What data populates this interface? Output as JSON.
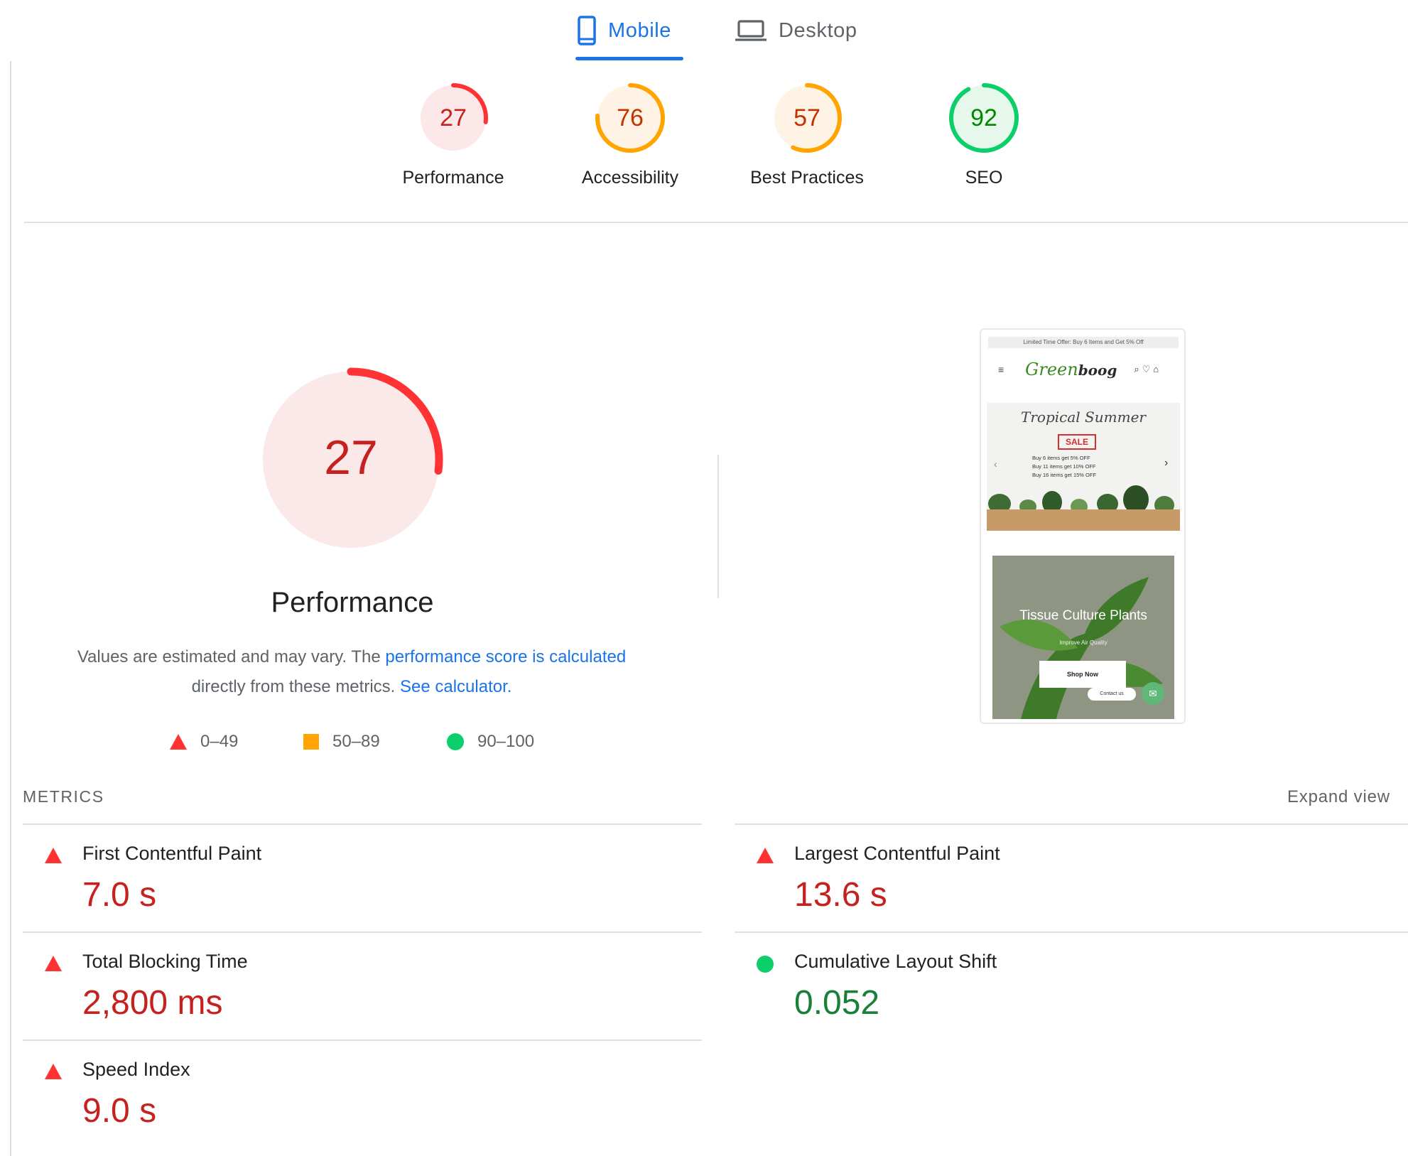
{
  "tabs": {
    "mobile": {
      "label": "Mobile",
      "icon": "smartphone-icon",
      "selected": true
    },
    "desktop": {
      "label": "Desktop",
      "icon": "laptop-icon",
      "selected": false
    }
  },
  "colors": {
    "red": "#ff3333",
    "red_text": "#c5221f",
    "orange": "#ffa400",
    "orange_text": "#c33300",
    "green": "#0cce6b",
    "green_text": "#008800",
    "link": "#1a73e8"
  },
  "categories": [
    {
      "score": "27",
      "label": "Performance",
      "status": "fail"
    },
    {
      "score": "76",
      "label": "Accessibility",
      "status": "average"
    },
    {
      "score": "57",
      "label": "Best Practices",
      "status": "average"
    },
    {
      "score": "92",
      "label": "SEO",
      "status": "pass"
    }
  ],
  "performance": {
    "score": "27",
    "title": "Performance",
    "desc_prefix": "Values are estimated and may vary. The ",
    "desc_link1": "performance score is calculated",
    "desc_middle": " directly from these metrics. ",
    "desc_link2": "See calculator."
  },
  "legend": [
    {
      "range": "0–49",
      "shape": "triangle"
    },
    {
      "range": "50–89",
      "shape": "square"
    },
    {
      "range": "90–100",
      "shape": "circle"
    }
  ],
  "screenshot": {
    "top_bar": "Limited Time Offer: Buy 6 Items and Get 5% Off",
    "logo_green": "Green",
    "logo_dark": "boog",
    "banner_title": "Tropical Summer",
    "sale": "SALE",
    "offer_lines": [
      "Buy 6 items get 5% OFF",
      "Buy 11 items get 10% OFF",
      "Buy 16 items get 15% OFF"
    ],
    "card_title": "Tissue Culture Plants",
    "card_subtitle": "Improve Air Quality",
    "shop_button": "Shop Now",
    "contact": "Contact us"
  },
  "metrics": {
    "header": "METRICS",
    "expand": "Expand view",
    "items": [
      {
        "title": "First Contentful Paint",
        "value": "7.0 s",
        "status": "fail"
      },
      {
        "title": "Largest Contentful Paint",
        "value": "13.6 s",
        "status": "fail"
      },
      {
        "title": "Total Blocking Time",
        "value": "2,800 ms",
        "status": "fail"
      },
      {
        "title": "Cumulative Layout Shift",
        "value": "0.052",
        "status": "pass"
      },
      {
        "title": "Speed Index",
        "value": "9.0 s",
        "status": "fail"
      }
    ]
  }
}
